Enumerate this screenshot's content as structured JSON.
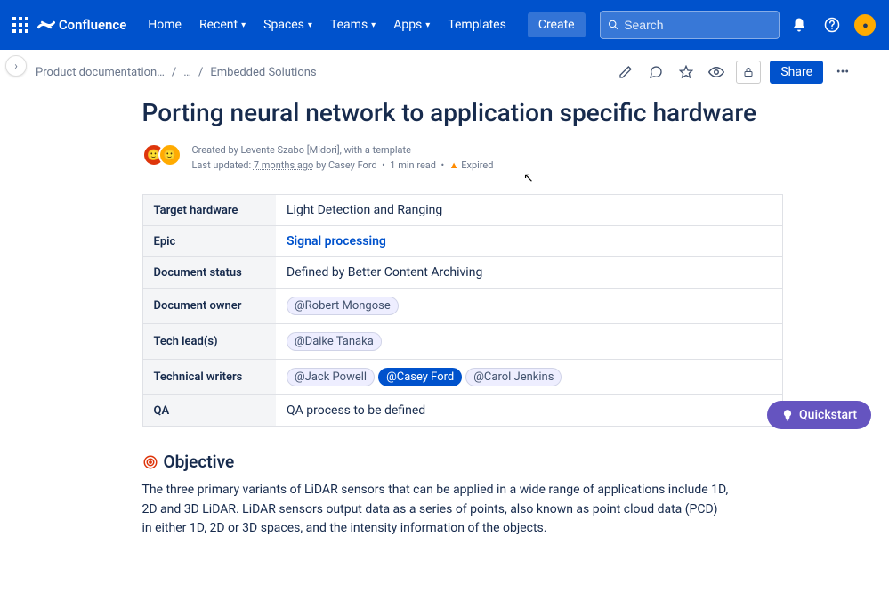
{
  "topbar": {
    "product": "Confluence",
    "nav": {
      "home": "Home",
      "recent": "Recent",
      "spaces": "Spaces",
      "teams": "Teams",
      "apps": "Apps",
      "templates": "Templates"
    },
    "create": "Create",
    "search_placeholder": "Search"
  },
  "breadcrumbs": {
    "root": "Product documentation…",
    "mid": "…",
    "leaf": "Embedded Solutions"
  },
  "actions": {
    "share": "Share"
  },
  "page": {
    "title": "Porting neural network to application specific hardware",
    "byline": {
      "created_by_prefix": "Created by ",
      "created_by": "Levente Szabo [Midori], with a template",
      "last_updated_label": "Last updated: ",
      "last_updated": "7 months ago",
      "by": " by Casey Ford",
      "read_time": "1 min read",
      "status_label": "Expired"
    },
    "table": {
      "rows": [
        {
          "label": "Target hardware",
          "type": "text",
          "value": "Light Detection and Ranging"
        },
        {
          "label": "Epic",
          "type": "link",
          "value": "Signal processing"
        },
        {
          "label": "Document status",
          "type": "text",
          "value": "Defined by Better Content Archiving"
        },
        {
          "label": "Document owner",
          "type": "mentions",
          "mentions": [
            "@Robert Mongose"
          ]
        },
        {
          "label": "Tech lead(s)",
          "type": "mentions",
          "mentions": [
            "@Daike Tanaka"
          ]
        },
        {
          "label": "Technical writers",
          "type": "mentions",
          "mentions": [
            "@Jack Powell",
            "@Casey Ford",
            "@Carol Jenkins"
          ],
          "primary_index": 1
        },
        {
          "label": "QA",
          "type": "text",
          "value": "QA process to be defined"
        }
      ]
    },
    "section": {
      "title": "Objective",
      "body": "The three primary variants of LiDAR sensors that can be applied in a wide range of applications include 1D, 2D and 3D LiDAR. LiDAR sensors output data as a series of points, also known as point cloud data (PCD) in either 1D, 2D or 3D spaces, and the intensity information of the objects."
    }
  },
  "quickstart": "Quickstart"
}
